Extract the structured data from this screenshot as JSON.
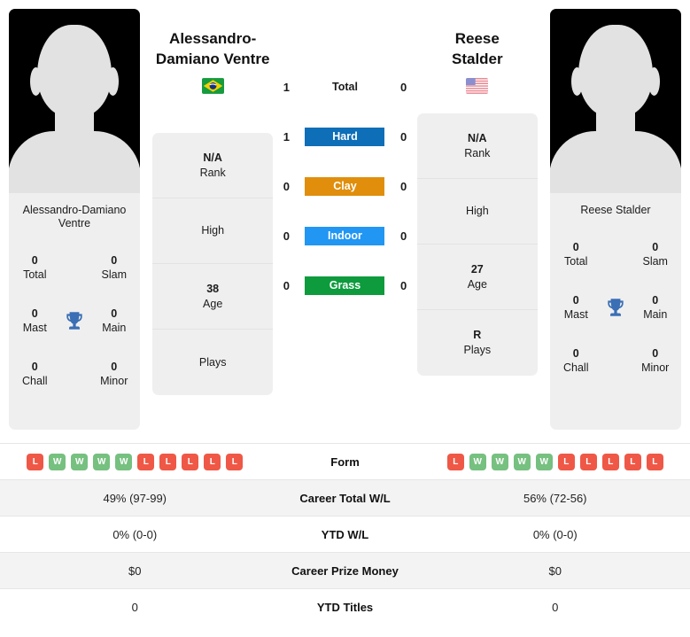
{
  "players": {
    "left": {
      "name_header": "Alessandro-\nDamiano Ventre",
      "name_line1": "Alessandro-",
      "name_line2": "Damiano Ventre",
      "card_name_line1": "Alessandro-Damiano",
      "card_name_line2": "Ventre",
      "flag": "brazil-flag",
      "info": [
        {
          "value": "N/A",
          "label": "Rank"
        },
        {
          "value": "",
          "label": "High"
        },
        {
          "value": "38",
          "label": "Age"
        },
        {
          "value": "",
          "label": "Plays"
        }
      ],
      "titles": [
        {
          "value": "0",
          "label": "Total"
        },
        {
          "value": "0",
          "label": "Slam"
        },
        {
          "value": "0",
          "label": "Mast"
        },
        {
          "value": "0",
          "label": "Main"
        },
        {
          "value": "0",
          "label": "Chall"
        },
        {
          "value": "0",
          "label": "Minor"
        }
      ],
      "form": [
        "L",
        "W",
        "W",
        "W",
        "W",
        "L",
        "L",
        "L",
        "L",
        "L"
      ],
      "career_total_wl": "49% (97-99)",
      "ytd_wl": "0% (0-0)",
      "career_prize_money": "$0",
      "ytd_titles": "0"
    },
    "right": {
      "name_line1": "Reese",
      "name_line2": "Stalder",
      "card_name_line1": "Reese Stalder",
      "card_name_line2": "",
      "flag": "usa-flag",
      "info": [
        {
          "value": "N/A",
          "label": "Rank"
        },
        {
          "value": "",
          "label": "High"
        },
        {
          "value": "27",
          "label": "Age"
        },
        {
          "value": "R",
          "label": "Plays"
        }
      ],
      "titles": [
        {
          "value": "0",
          "label": "Total"
        },
        {
          "value": "0",
          "label": "Slam"
        },
        {
          "value": "0",
          "label": "Mast"
        },
        {
          "value": "0",
          "label": "Main"
        },
        {
          "value": "0",
          "label": "Chall"
        },
        {
          "value": "0",
          "label": "Minor"
        }
      ],
      "form": [
        "L",
        "W",
        "W",
        "W",
        "W",
        "L",
        "L",
        "L",
        "L",
        "L"
      ],
      "career_total_wl": "56% (72-56)",
      "ytd_wl": "0% (0-0)",
      "career_prize_money": "$0",
      "ytd_titles": "0"
    }
  },
  "surfaces": [
    {
      "label": "Total",
      "left": "1",
      "right": "0",
      "color": ""
    },
    {
      "label": "Hard",
      "left": "1",
      "right": "0",
      "color": "#0e6eb8"
    },
    {
      "label": "Clay",
      "left": "0",
      "right": "0",
      "color": "#e08e0b"
    },
    {
      "label": "Indoor",
      "left": "0",
      "right": "0",
      "color": "#2196f3"
    },
    {
      "label": "Grass",
      "left": "0",
      "right": "0",
      "color": "#0e9b3d"
    }
  ],
  "table": {
    "form_label": "Form",
    "rows": [
      {
        "label": "Career Total W/L",
        "left": "49% (97-99)",
        "right": "56% (72-56)"
      },
      {
        "label": "YTD W/L",
        "left": "0% (0-0)",
        "right": "0% (0-0)"
      },
      {
        "label": "Career Prize Money",
        "left": "$0",
        "right": "$0"
      },
      {
        "label": "YTD Titles",
        "left": "0",
        "right": "0"
      }
    ]
  },
  "colors": {
    "win_badge": "#76c080",
    "loss_badge": "#ef5846",
    "trophy": "#3a6eb5",
    "card_bg": "#efefef",
    "row_alt": "#f3f3f3"
  }
}
